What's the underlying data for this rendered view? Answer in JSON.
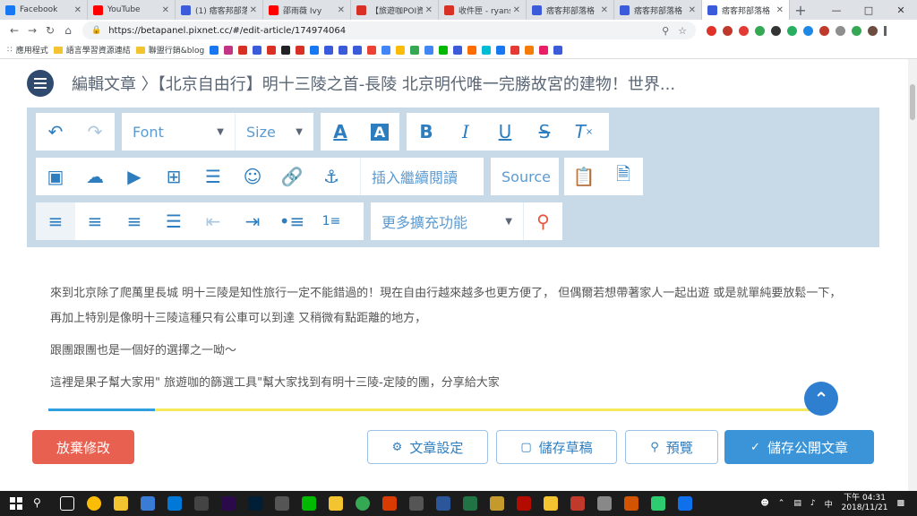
{
  "browser": {
    "tabs": [
      {
        "title": "Facebook",
        "color": "#1877f2",
        "active": false
      },
      {
        "title": "YouTube",
        "color": "#ff0000",
        "active": false
      },
      {
        "title": "(1) 痞客邦部落",
        "color": "#3b5bdb",
        "active": false
      },
      {
        "title": "邵雨薇 Ivy",
        "color": "#ff0000",
        "active": false
      },
      {
        "title": "【旅遊咖POI資",
        "color": "#d93025",
        "active": false
      },
      {
        "title": "收件匣 - ryans",
        "color": "#d93025",
        "active": false
      },
      {
        "title": "痞客邦部落格",
        "color": "#3b5bdb",
        "active": false
      },
      {
        "title": "痞客邦部落格",
        "color": "#3b5bdb",
        "active": false
      },
      {
        "title": "痞客邦部落格",
        "color": "#3b5bdb",
        "active": true
      }
    ],
    "url": "https://betapanel.pixnet.cc/#/edit-article/174974064",
    "bookmarks": [
      "應用程式",
      "語言學習資源連結",
      "聯盟行銷&blog"
    ]
  },
  "header": {
    "breadcrumb": "編輯文章 〉【北京自由行】明十三陵之首-長陵 北京明代唯一完勝故宮的建物！世界..."
  },
  "toolbar": {
    "font_label": "Font",
    "size_label": "Size",
    "read_more_label": "插入繼續閱讀",
    "source_label": "Source",
    "more_label": "更多擴充功能"
  },
  "content": {
    "paragraphs": [
      "來到北京除了爬萬里長城 明十三陵是知性旅行一定不能錯過的！現在自由行越來越多也更方便了， 但偶爾若想帶著家人一起出遊 或是就單純要放鬆一下， 再加上特別是像明十三陵這種只有公車可以到達 又稍微有點距離的地方，",
      "跟團跟團也是一個好的選擇之一呦～",
      "這裡是果子幫大家用\" 旅遊咖的篩選工具\"幫大家找到有明十三陵-定陵的團，分享給大家"
    ],
    "progress": 0.14
  },
  "footer": {
    "discard": "放棄修改",
    "settings": "文章設定",
    "draft": "儲存草稿",
    "preview": "預覽",
    "publish": "儲存公開文章"
  },
  "taskbar": {
    "time": "下午 04:31",
    "date": "2018/11/21",
    "ime": "中"
  },
  "colors": {
    "accent": "#3b94d8",
    "discard": "#e86050",
    "nav_dark": "#2f4a6e"
  }
}
